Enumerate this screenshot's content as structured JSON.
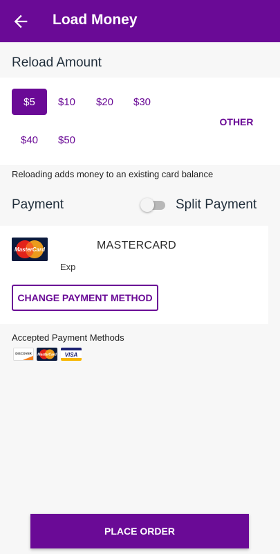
{
  "header": {
    "title": "Load Money"
  },
  "reload": {
    "title": "Reload Amount",
    "amounts": [
      "$5",
      "$10",
      "$20",
      "$30",
      "$40",
      "$50"
    ],
    "selected": "$5",
    "other_label": "OTHER",
    "info": "Reloading adds money to an existing card balance"
  },
  "payment": {
    "label": "Payment",
    "split_label": "Split Payment",
    "split_enabled": false
  },
  "card": {
    "brand": "MASTERCARD",
    "logo_text": "MasterCard",
    "exp_label": "Exp",
    "change_button": "CHANGE PAYMENT METHOD"
  },
  "accepted": {
    "label": "Accepted Payment Methods",
    "logos": [
      {
        "icon": "discover-icon",
        "text": "DISCOVER"
      },
      {
        "icon": "mastercard-icon",
        "text": "MasterCard"
      },
      {
        "icon": "visa-icon",
        "text": "VISA"
      }
    ]
  },
  "footer": {
    "place_order": "PLACE ORDER"
  },
  "colors": {
    "primary": "#6a0a96",
    "background": "#f7f7f7",
    "panel": "#ffffff"
  }
}
